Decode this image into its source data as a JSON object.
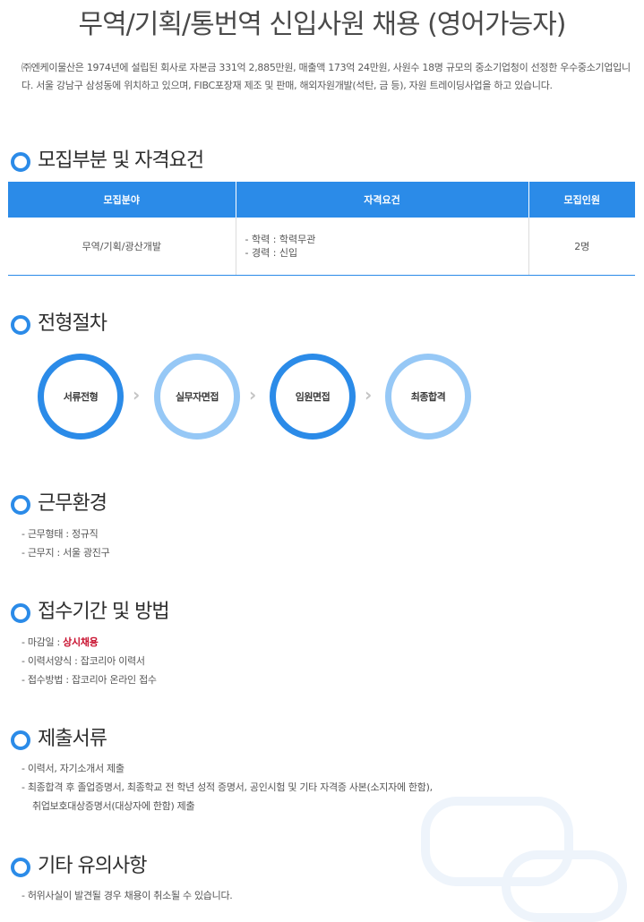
{
  "title": "무역/기획/통번역 신입사원 채용 (영어가능자)",
  "intro": "㈜엔케이물산은 1974년에 설립된 회사로 자본금 331억 2,885만원, 매출액 173억 24만원, 사원수 18명 규모의 중소기업청이 선정한 우수중소기업입니다. 서울 강남구 삼성동에 위치하고 있으며, FIBC포장재 제조 및 판매, 해외자원개발(석탄, 금 등), 자원 트레이딩사업을 하고 있습니다.",
  "sections": {
    "recruit": {
      "heading": "모집부분 및 자격요건",
      "table": {
        "headers": [
          "모집분야",
          "자격요건",
          "모집인원"
        ],
        "row": {
          "field": "무역/기획/광산개발",
          "qual_line1": "- 학력 : 학력무관",
          "qual_line2": "- 경력 : 신입",
          "count": "2명"
        }
      }
    },
    "process": {
      "heading": "전형절차",
      "steps": [
        "서류전형",
        "실무자면접",
        "임원면접",
        "최종합격"
      ]
    },
    "work": {
      "heading": "근무환경",
      "items": [
        "- 근무형태 : 정규직",
        "- 근무지 : 서울 광진구"
      ]
    },
    "apply": {
      "heading": "접수기간 및 방법",
      "deadline_prefix": "- 마감일 : ",
      "deadline_value": "상시채용",
      "items": [
        "- 이력서양식 : 잡코리아 이력서",
        "- 접수방법 : 잡코리아 온라인 접수"
      ]
    },
    "docs": {
      "heading": "제출서류",
      "items": [
        "- 이력서, 자기소개서 제출",
        "- 최종합격 후 졸업증명서, 최종학교 전 학년 성적 증명서, 공인시험 및 기타 자격증 사본(소지자에 한함),",
        "취업보호대상증명서(대상자에 한함) 제출"
      ]
    },
    "etc": {
      "heading": "기타 유의사항",
      "items": [
        "- 허위사실이 발견될 경우 채용이 취소될 수 있습니다."
      ]
    }
  },
  "colors": {
    "accent": "#2b8be8",
    "accent_light": "#96c8f6",
    "highlight": "#c8102e"
  }
}
